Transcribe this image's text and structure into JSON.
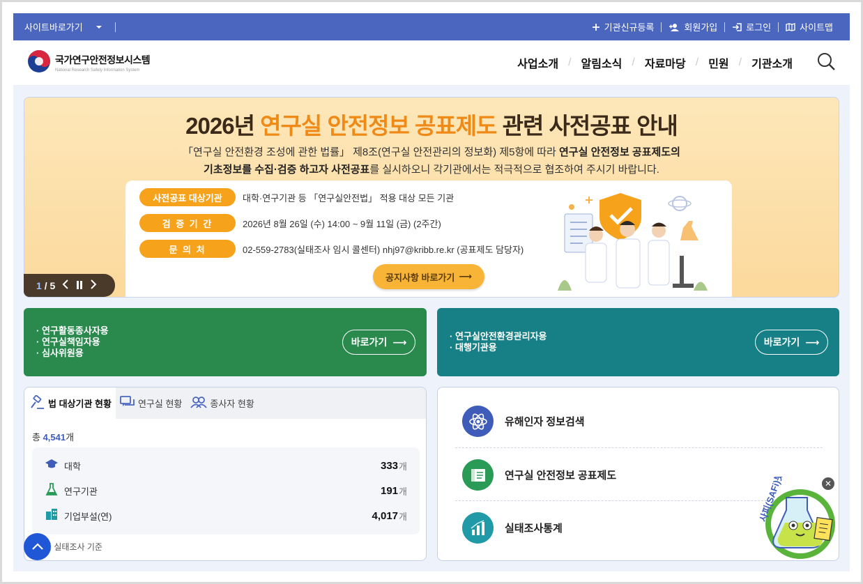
{
  "topbar": {
    "shortcut_label": "사이트바로가기",
    "links": [
      {
        "label": "기관신규등록",
        "icon": "plus-icon"
      },
      {
        "label": "회원가입",
        "icon": "add-user-icon"
      },
      {
        "label": "로그인",
        "icon": "login-icon"
      },
      {
        "label": "사이트맵",
        "icon": "map-icon"
      }
    ]
  },
  "header": {
    "logo_title": "국가연구안전정보시스템",
    "logo_subtitle": "National Research Safety Information System",
    "nav": [
      "사업소개",
      "알림소식",
      "자료마당",
      "민원",
      "기관소개"
    ]
  },
  "banner": {
    "title_part1": "2026년 ",
    "title_highlight": "연구실 안전정보 공표제도",
    "title_part2": " 관련 사전공표 안내",
    "desc_line1_a": "「연구실 안전환경 조성에 관한 법률」 제8조(연구실 안전관리의 정보화) 제5항에 따라 ",
    "desc_line1_b": "연구실 안전정보 공표제도의",
    "desc_line2_a": "기초정보를 수집·검증 하고자 사전공표",
    "desc_line2_b": "를 실시하오니 각기관에서는 적극적으로 협조하여 주시기 바랍니다.",
    "rows": [
      {
        "label": "사전공표 대상기관",
        "value": "대학·연구기관 등 「연구실안전법」 적용 대상 모든 기관"
      },
      {
        "label": "검 증 기 간",
        "value": "2026년 8월 26일 (수) 14:00 ~ 9월 11일 (금) (2주간)"
      },
      {
        "label": "문 의 처",
        "value": "02-559-2783(실태조사 임시 콜센터)  nhj97@kribb.re.kr (공표제도 담당자)"
      }
    ],
    "notice_button": "공지사항 바로가기",
    "pager_current": "1",
    "pager_total": "/ 5"
  },
  "cta": [
    {
      "items": [
        "· 연구활동종사자용",
        "· 연구실책임자용",
        "· 심사위원용"
      ],
      "button": "바로가기",
      "color": "#2a8a4e"
    },
    {
      "items": [
        "· 연구실안전환경관리자용",
        "· 대행기관용"
      ],
      "button": "바로가기",
      "color": "#178086"
    }
  ],
  "stats": {
    "tabs": [
      {
        "label": "법 대상기관 현황",
        "icon": "gavel-icon",
        "active": true
      },
      {
        "label": "연구실 현황",
        "icon": "chat-icon",
        "active": false
      },
      {
        "label": "종사자 현황",
        "icon": "people-icon",
        "active": false
      }
    ],
    "total_prefix": "총 ",
    "total_value": "4,541",
    "total_suffix": "개",
    "rows": [
      {
        "label": "대학",
        "value": "333",
        "unit": "개",
        "icon": "graduation-cap-icon"
      },
      {
        "label": "연구기관",
        "value": "191",
        "unit": "개",
        "icon": "flask-icon"
      },
      {
        "label": "기업부설(연)",
        "value": "4,017",
        "unit": "개",
        "icon": "building-icon"
      }
    ],
    "basis": "년 실태조사 기준"
  },
  "quick_links": [
    {
      "label": "유해인자 정보검색",
      "icon": "atom-icon",
      "color": "#3e5cb8"
    },
    {
      "label": "연구실 안전정보 공표제도",
      "icon": "book-icon",
      "color": "#2a9a57"
    },
    {
      "label": "실태조사통계",
      "icon": "bar-chart-icon",
      "color": "#1f9aa6"
    }
  ],
  "mascot": {
    "text": "사피(SAFi)봇",
    "close": "✕"
  }
}
